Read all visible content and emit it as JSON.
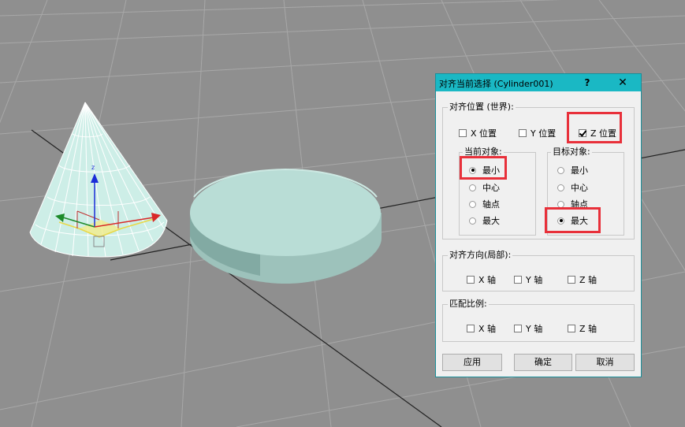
{
  "viewport": {
    "background": "#8f8f8f",
    "grid_color": "#a5a5a5",
    "axis_color": "#222222"
  },
  "dialog": {
    "title": "对齐当前选择 (Cylinder001)",
    "help_label": "?",
    "close_label": "✕",
    "align_position": {
      "label": "对齐位置 (世界):",
      "x_label": "X 位置",
      "y_label": "Y 位置",
      "z_label": "Z 位置",
      "x_checked": false,
      "y_checked": false,
      "z_checked": true
    },
    "current_object": {
      "label": "当前对象:",
      "options": [
        "最小",
        "中心",
        "轴点",
        "最大"
      ],
      "selected": "最小"
    },
    "target_object": {
      "label": "目标对象:",
      "options": [
        "最小",
        "中心",
        "轴点",
        "最大"
      ],
      "selected": "最大"
    },
    "align_orientation": {
      "label": "对齐方向(局部):",
      "x_label": "X 轴",
      "y_label": "Y 轴",
      "z_label": "Z 轴"
    },
    "match_scale": {
      "label": "匹配比例:",
      "x_label": "X 轴",
      "y_label": "Y 轴",
      "z_label": "Z 轴"
    },
    "buttons": {
      "apply": "应用",
      "ok": "确定",
      "cancel": "取消"
    }
  },
  "gizmo": {
    "axis_label": "z"
  },
  "highlight_color": "#e8303a"
}
